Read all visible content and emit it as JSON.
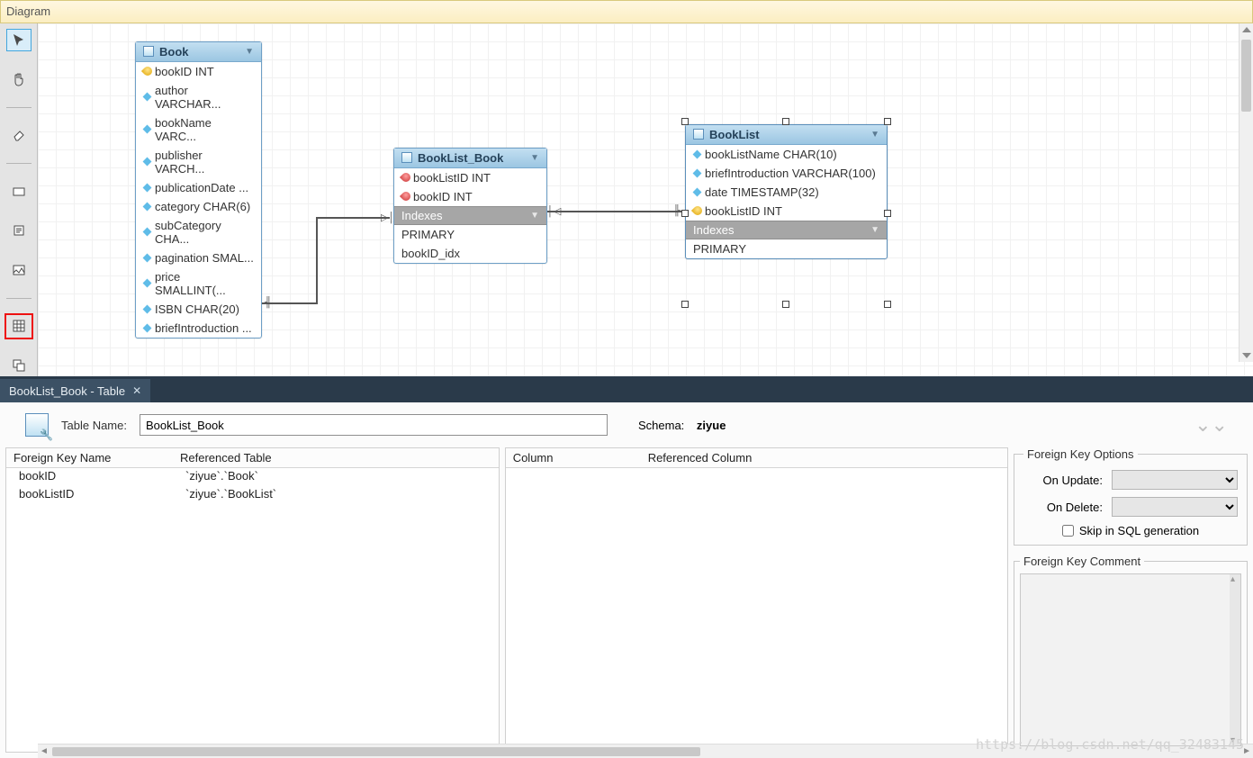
{
  "ribbon_title": "Diagram",
  "toolbar": [
    {
      "name": "pointer",
      "selected": true
    },
    {
      "name": "hand"
    },
    {
      "name": "eraser"
    },
    {
      "name": "layer"
    },
    {
      "name": "note"
    },
    {
      "name": "image"
    },
    {
      "name": "table-tool",
      "highlight": true
    },
    {
      "name": "routine"
    }
  ],
  "entities": {
    "book": {
      "title": "Book",
      "columns": [
        {
          "kind": "pk",
          "text": "bookID INT"
        },
        {
          "kind": "col",
          "text": "author VARCHAR..."
        },
        {
          "kind": "col",
          "text": "bookName VARC..."
        },
        {
          "kind": "col",
          "text": "publisher VARCH..."
        },
        {
          "kind": "col",
          "text": "publicationDate ..."
        },
        {
          "kind": "col",
          "text": "category CHAR(6)"
        },
        {
          "kind": "col",
          "text": "subCategory CHA..."
        },
        {
          "kind": "col",
          "text": "pagination SMAL..."
        },
        {
          "kind": "col",
          "text": "price SMALLINT(..."
        },
        {
          "kind": "col",
          "text": "ISBN CHAR(20)"
        },
        {
          "kind": "col",
          "text": "briefIntroduction ..."
        }
      ]
    },
    "booklist_book": {
      "title": "BookList_Book",
      "columns": [
        {
          "kind": "fk",
          "text": "bookListID INT"
        },
        {
          "kind": "fk",
          "text": "bookID INT"
        }
      ],
      "indexes_label": "Indexes",
      "indexes": [
        "PRIMARY",
        "bookID_idx"
      ]
    },
    "booklist": {
      "title": "BookList",
      "columns": [
        {
          "kind": "col",
          "text": "bookListName CHAR(10)"
        },
        {
          "kind": "col",
          "text": "briefIntroduction VARCHAR(100)"
        },
        {
          "kind": "col",
          "text": "date TIMESTAMP(32)"
        },
        {
          "kind": "pk",
          "text": "bookListID INT"
        }
      ],
      "indexes_label": "Indexes",
      "indexes": [
        "PRIMARY"
      ]
    }
  },
  "tab": {
    "label": "BookList_Book - Table"
  },
  "form": {
    "table_name_label": "Table Name:",
    "table_name_value": "BookList_Book",
    "schema_label": "Schema:",
    "schema_value": "ziyue"
  },
  "fk_table": {
    "header1": "Foreign Key Name",
    "header2": "Referenced Table",
    "rows": [
      {
        "name": "bookID",
        "ref": "`ziyue`.`Book`"
      },
      {
        "name": "bookListID",
        "ref": "`ziyue`.`BookList`"
      }
    ]
  },
  "col_table": {
    "header1": "Column",
    "header2": "Referenced Column"
  },
  "options": {
    "legend": "Foreign Key Options",
    "on_update": "On Update:",
    "on_delete": "On Delete:",
    "skip": "Skip in SQL generation"
  },
  "comment_legend": "Foreign Key Comment",
  "watermark": "https://blog.csdn.net/qq_32483145"
}
